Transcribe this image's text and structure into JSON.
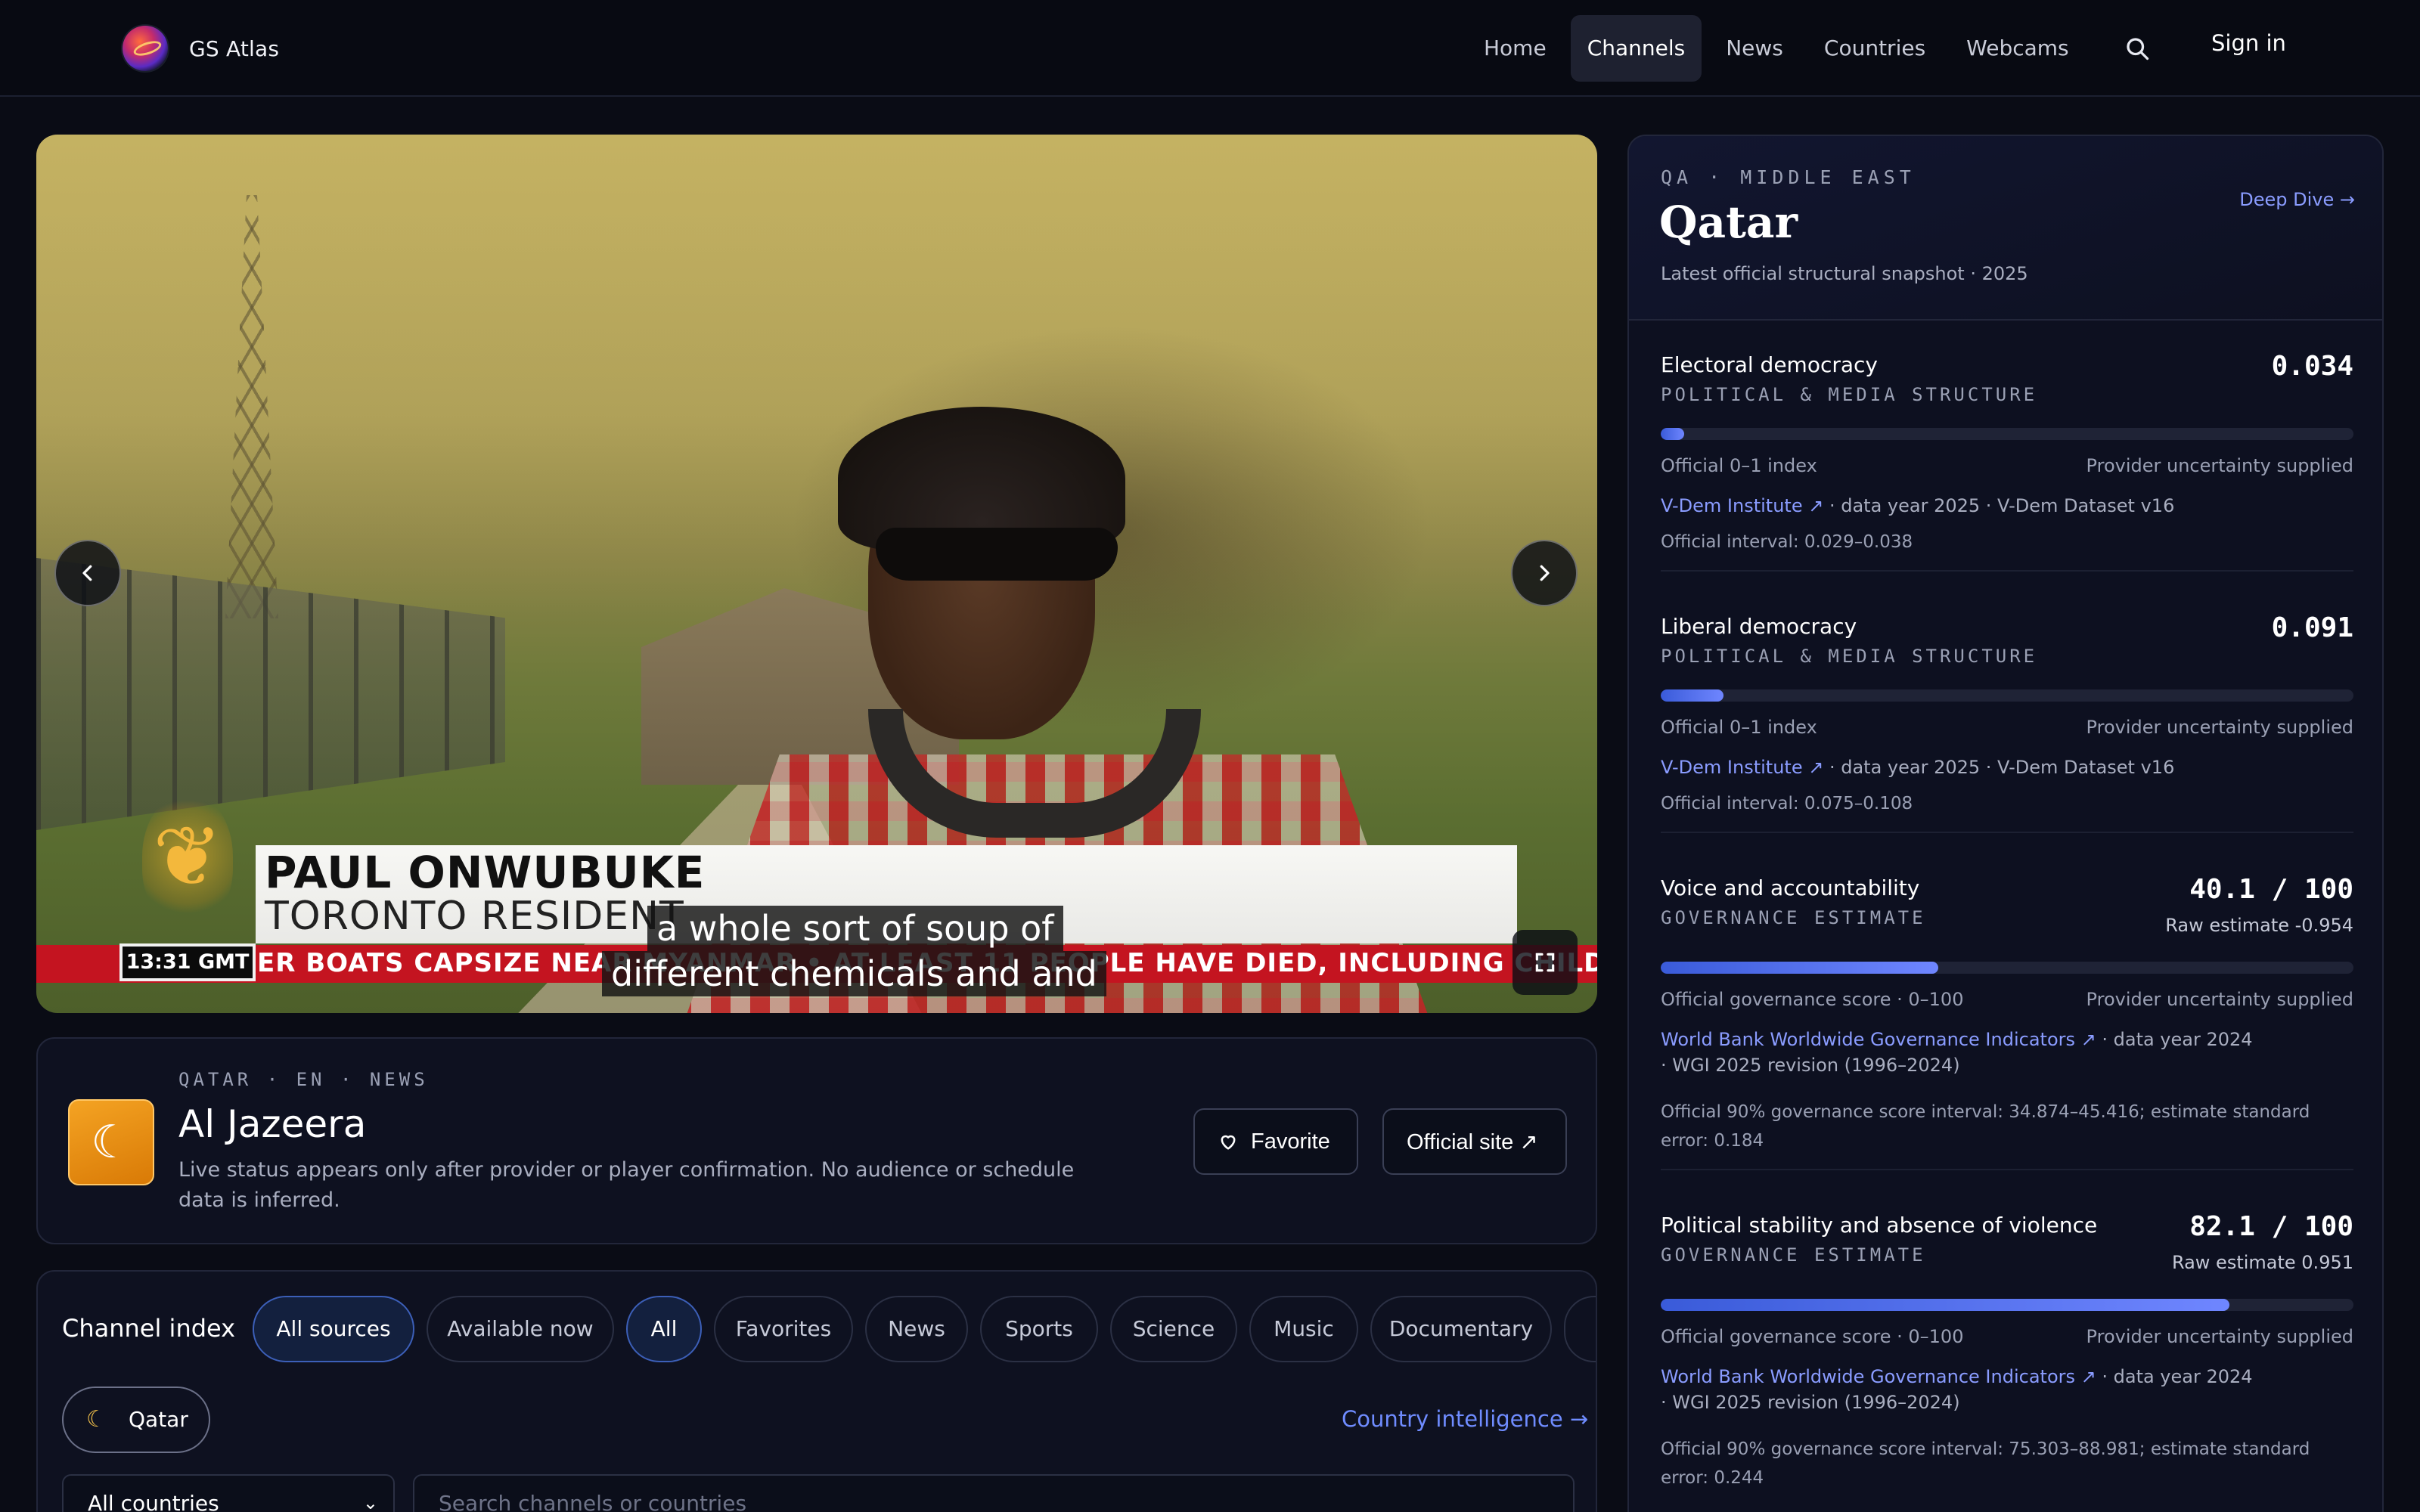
{
  "header": {
    "brand": "GS Atlas",
    "nav": [
      "Home",
      "Channels",
      "News",
      "Countries",
      "Webcams"
    ],
    "active_nav": "Channels",
    "sign_in": "Sign in"
  },
  "player": {
    "overlay": {
      "name": "PAUL ONWUBUKE",
      "role": "TORONTO RESIDENT",
      "ticker": "ER BOATS CAPSIZE NEAR MYANMAR  •  AT LEAST 11 PEOPLE HAVE DIED, INCLUDING CHILDREN, AFTER FI",
      "clock": "13:31  GMT",
      "caption_line1": "a whole sort of soup of",
      "caption_line2": "different chemicals and and"
    }
  },
  "channel": {
    "meta": "QATAR · EN · NEWS",
    "name": "Al Jazeera",
    "description": "Live status appears only after provider or player confirmation. No audience or schedule data is inferred.",
    "favorite_label": "Favorite",
    "official_site_label": "Official site ↗"
  },
  "channel_index": {
    "title": "Channel index",
    "filters": [
      "All sources",
      "Available now",
      "All",
      "Favorites",
      "News",
      "Sports",
      "Science",
      "Music",
      "Documentary"
    ],
    "active_filters": [
      "All sources",
      "All"
    ],
    "country_chip": "Qatar",
    "country_link": "Country intelligence →",
    "country_select": "All countries",
    "search_placeholder": "Search channels or countries"
  },
  "country_panel": {
    "meta": "QA · MIDDLE EAST",
    "title": "Qatar",
    "subtitle": "Latest official structural snapshot · 2025",
    "deep_dive": "Deep Dive →",
    "metrics": [
      {
        "label": "Electoral democracy",
        "category": "POLITICAL & MEDIA STRUCTURE",
        "value": "0.034",
        "raw": "",
        "fill_fraction": 0.034,
        "scale": "Official 0–1 index",
        "uncertainty": "Provider uncertainty supplied",
        "source": "V-Dem Institute ↗",
        "source_detail": " · data year 2025  · V-Dem Dataset v16",
        "interval": "Official interval: 0.029–0.038"
      },
      {
        "label": "Liberal democracy",
        "category": "POLITICAL & MEDIA STRUCTURE",
        "value": "0.091",
        "raw": "",
        "fill_fraction": 0.091,
        "scale": "Official 0–1 index",
        "uncertainty": "Provider uncertainty supplied",
        "source": "V-Dem Institute ↗",
        "source_detail": " · data year 2025  · V-Dem Dataset v16",
        "interval": "Official interval: 0.075–0.108"
      },
      {
        "label": "Voice and accountability",
        "category": "GOVERNANCE ESTIMATE",
        "value": "40.1 / 100",
        "raw": "Raw estimate -0.954",
        "fill_fraction": 0.401,
        "scale": "Official governance score · 0–100",
        "uncertainty": "Provider uncertainty supplied",
        "source": "World Bank Worldwide Governance Indicators ↗",
        "source_detail": " · data year 2024",
        "source_detail2": "· WGI 2025 revision (1996–2024)",
        "interval": "Official 90% governance score interval: 34.874–45.416; estimate standard error: 0.184"
      },
      {
        "label": "Political stability and absence of violence",
        "category": "GOVERNANCE ESTIMATE",
        "value": "82.1 / 100",
        "raw": "Raw estimate 0.951",
        "fill_fraction": 0.821,
        "scale": "Official governance score · 0–100",
        "uncertainty": "Provider uncertainty supplied",
        "source": "World Bank Worldwide Governance Indicators ↗",
        "source_detail": " · data year 2024",
        "source_detail2": "· WGI 2025 revision (1996–2024)",
        "interval": "Official 90% governance score interval: 75.303–88.981; estimate standard error: 0.244"
      }
    ]
  },
  "icons": {
    "search": "search-icon",
    "prev": "chevron-left-icon",
    "next": "chevron-right-icon",
    "fullscreen": "fullscreen-icon",
    "heart": "heart-icon",
    "moon": "crescent-moon-icon"
  },
  "colors": {
    "accent": "#6f8cff",
    "background": "#0a0c15",
    "ticker_red": "#c41420",
    "channel_icon": "#f4a323"
  }
}
